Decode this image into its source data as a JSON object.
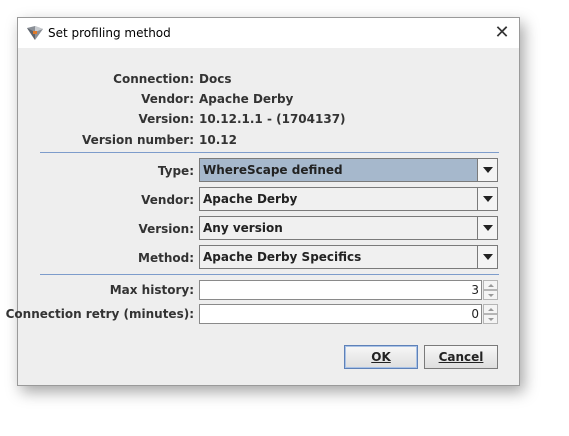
{
  "window": {
    "title": "Set profiling method",
    "close_glyph": "✕"
  },
  "info": [
    {
      "label": "Connection:",
      "value": "Docs"
    },
    {
      "label": "Vendor:",
      "value": "Apache Derby"
    },
    {
      "label": "Version:",
      "value": "10.12.1.1 - (1704137)"
    },
    {
      "label": "Version number:",
      "value": "10.12"
    }
  ],
  "form": {
    "type": {
      "label": "Type:",
      "value": "WhereScape defined"
    },
    "vendor": {
      "label": "Vendor:",
      "value": "Apache Derby"
    },
    "version": {
      "label": "Version:",
      "value": "Any version"
    },
    "method": {
      "label": "Method:",
      "value": "Apache Derby Specifics"
    },
    "max_history": {
      "label": "Max history:",
      "value": "3"
    },
    "connection_retry": {
      "label": "Connection retry (minutes):",
      "value": "0"
    }
  },
  "buttons": {
    "ok": "OK",
    "cancel": "Cancel"
  },
  "colors": {
    "separator": "#7d9ccb",
    "selected_combo": "#a6b8cc",
    "dialog_bg": "#eeeeee"
  }
}
